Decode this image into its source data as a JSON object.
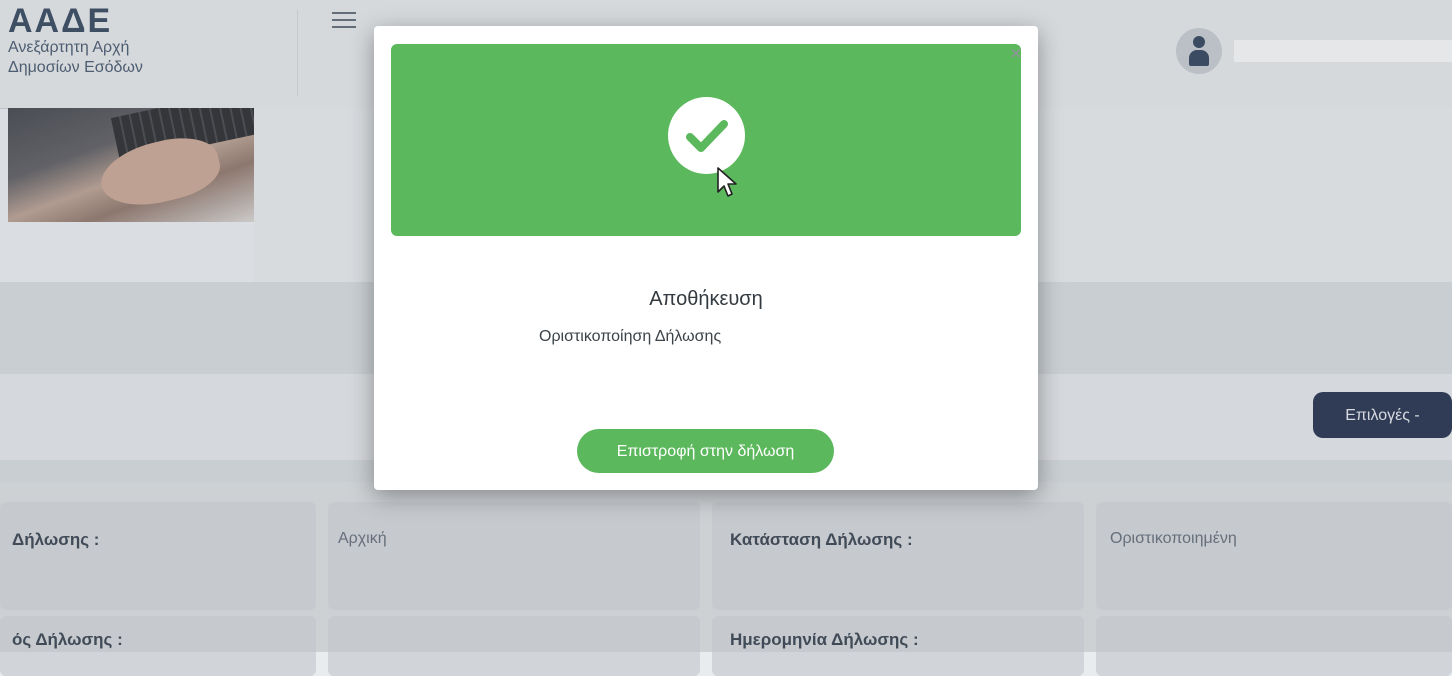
{
  "header": {
    "logo_mark": "ΑΑΔΕ",
    "logo_line1": "Ανεξάρτητη Αρχή",
    "logo_line2": "Δημοσίων Εσόδων"
  },
  "toolbar": {
    "options_label": "Επιλογές -"
  },
  "details": [
    {
      "label": "Δήλωσης :",
      "value": "Αρχική",
      "label2": "Κατάσταση Δήλωσης :",
      "value2": "Οριστικοποιημένη"
    },
    {
      "label": "ός Δήλωσης :",
      "value": "",
      "label2": "Ημερομηνία Δήλωσης :",
      "value2": ""
    }
  ],
  "modal": {
    "close_glyph": "×",
    "title": "Αποθήκευση",
    "message": "Οριστικοποίηση Δήλωσης",
    "return_label": "Επιστροφή στην δήλωση"
  },
  "colors": {
    "success": "#5cb85c",
    "navy_button": "#1a2845",
    "brand": "#2b3f57"
  },
  "icons": [
    "menu-icon",
    "user-icon",
    "check-circle-icon",
    "cursor-icon",
    "close-icon"
  ]
}
